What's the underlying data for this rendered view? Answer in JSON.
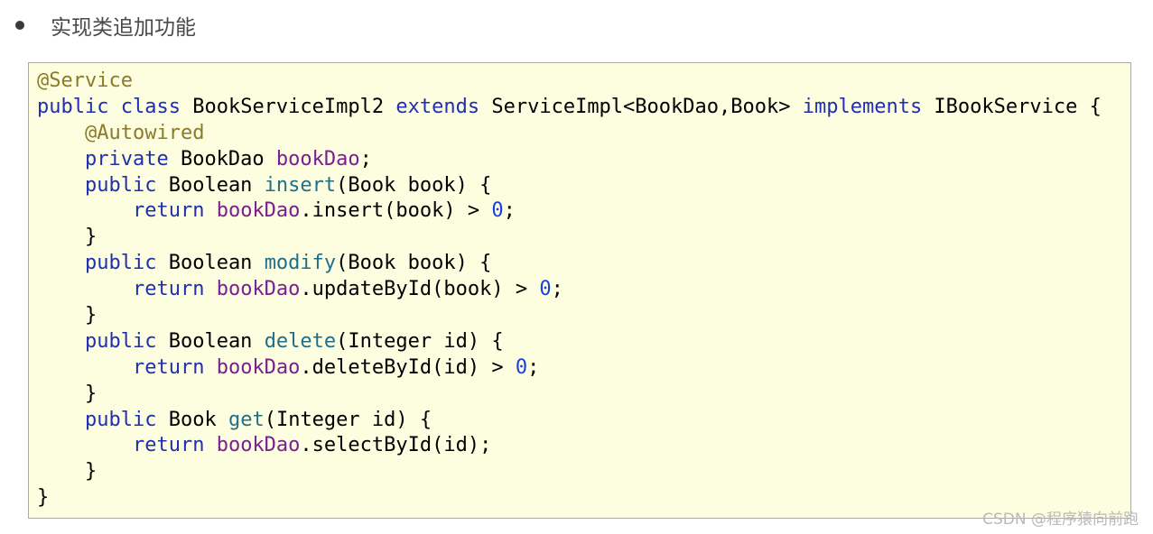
{
  "heading": {
    "text": "实现类追加功能"
  },
  "code": {
    "lines": [
      [
        [
          "ann",
          "@Service"
        ]
      ],
      [
        [
          "kw",
          "public"
        ],
        [
          "plain",
          " "
        ],
        [
          "kw",
          "class"
        ],
        [
          "plain",
          " BookServiceImpl2 "
        ],
        [
          "kw",
          "extends"
        ],
        [
          "plain",
          " ServiceImpl<BookDao,Book> "
        ],
        [
          "kw",
          "implements"
        ],
        [
          "plain",
          " IBookService {"
        ]
      ],
      [
        [
          "plain",
          "    "
        ],
        [
          "ann",
          "@Autowired"
        ]
      ],
      [
        [
          "plain",
          "    "
        ],
        [
          "kw",
          "private"
        ],
        [
          "plain",
          " BookDao "
        ],
        [
          "fld",
          "bookDao"
        ],
        [
          "plain",
          ";"
        ]
      ],
      [
        [
          "plain",
          "    "
        ],
        [
          "kw",
          "public"
        ],
        [
          "plain",
          " Boolean "
        ],
        [
          "mth",
          "insert"
        ],
        [
          "plain",
          "(Book book) {"
        ]
      ],
      [
        [
          "plain",
          "        "
        ],
        [
          "kw",
          "return"
        ],
        [
          "plain",
          " "
        ],
        [
          "fld",
          "bookDao"
        ],
        [
          "plain",
          ".insert(book) > "
        ],
        [
          "num",
          "0"
        ],
        [
          "plain",
          ";"
        ]
      ],
      [
        [
          "plain",
          "    }"
        ]
      ],
      [
        [
          "plain",
          "    "
        ],
        [
          "kw",
          "public"
        ],
        [
          "plain",
          " Boolean "
        ],
        [
          "mth",
          "modify"
        ],
        [
          "plain",
          "(Book book) {"
        ]
      ],
      [
        [
          "plain",
          "        "
        ],
        [
          "kw",
          "return"
        ],
        [
          "plain",
          " "
        ],
        [
          "fld",
          "bookDao"
        ],
        [
          "plain",
          ".updateById(book) > "
        ],
        [
          "num",
          "0"
        ],
        [
          "plain",
          ";"
        ]
      ],
      [
        [
          "plain",
          "    }"
        ]
      ],
      [
        [
          "plain",
          "    "
        ],
        [
          "kw",
          "public"
        ],
        [
          "plain",
          " Boolean "
        ],
        [
          "mth",
          "delete"
        ],
        [
          "plain",
          "(Integer id) {"
        ]
      ],
      [
        [
          "plain",
          "        "
        ],
        [
          "kw",
          "return"
        ],
        [
          "plain",
          " "
        ],
        [
          "fld",
          "bookDao"
        ],
        [
          "plain",
          ".deleteById(id) > "
        ],
        [
          "num",
          "0"
        ],
        [
          "plain",
          ";"
        ]
      ],
      [
        [
          "plain",
          "    }"
        ]
      ],
      [
        [
          "plain",
          "    "
        ],
        [
          "kw",
          "public"
        ],
        [
          "plain",
          " Book "
        ],
        [
          "mth",
          "get"
        ],
        [
          "plain",
          "(Integer id) {"
        ]
      ],
      [
        [
          "plain",
          "        "
        ],
        [
          "kw",
          "return"
        ],
        [
          "plain",
          " "
        ],
        [
          "fld",
          "bookDao"
        ],
        [
          "plain",
          ".selectById(id);"
        ]
      ],
      [
        [
          "plain",
          "    }"
        ]
      ],
      [
        [
          "plain",
          "}"
        ]
      ]
    ],
    "colors": {
      "keyword": "#1f2fb0",
      "annotation": "#8b7a2a",
      "field": "#7a1f8f",
      "number": "#1a3fe0",
      "method": "#1e6f8a",
      "background": "#fdfde0"
    }
  },
  "watermark": {
    "text": "CSDN @程序猿向前跑"
  }
}
